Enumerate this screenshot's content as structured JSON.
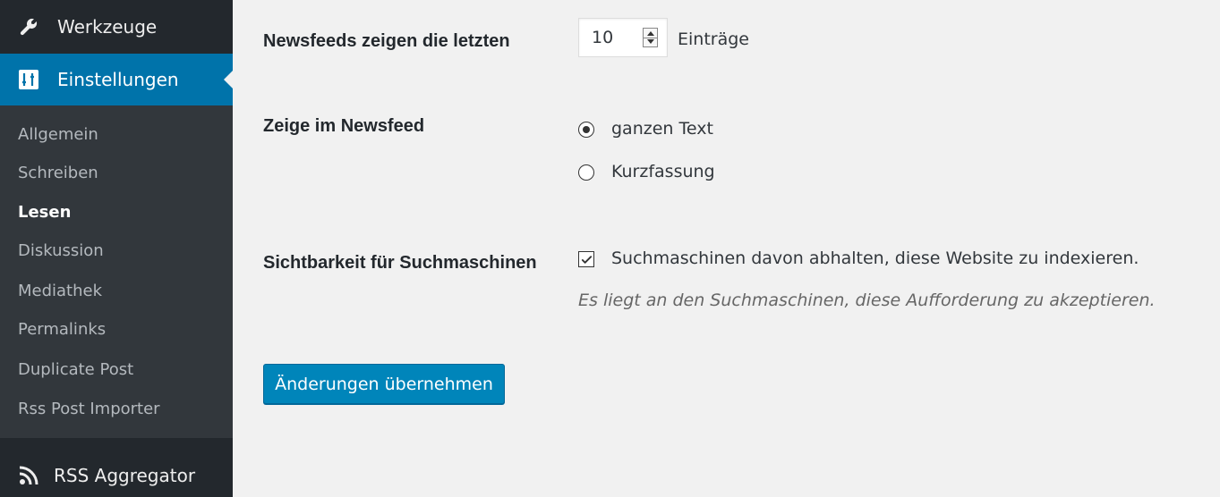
{
  "sidebar": {
    "menu": [
      {
        "label": "Werkzeuge",
        "icon": "wrench-icon"
      },
      {
        "label": "Einstellungen",
        "icon": "settings-sliders-icon",
        "active": true
      }
    ],
    "submenu": [
      {
        "label": "Allgemein"
      },
      {
        "label": "Schreiben"
      },
      {
        "label": "Lesen",
        "current": true
      },
      {
        "label": "Diskussion"
      },
      {
        "label": "Mediathek"
      },
      {
        "label": "Permalinks"
      },
      {
        "label": "Duplicate Post"
      },
      {
        "label": "Rss Post Importer"
      }
    ],
    "rss": {
      "label": "RSS Aggregator",
      "icon": "rss-icon"
    }
  },
  "settings": {
    "feed_count": {
      "label": "Newsfeeds zeigen die letzten",
      "value": "10",
      "suffix": "Einträge"
    },
    "feed_content": {
      "label": "Zeige im Newsfeed",
      "options": [
        {
          "label": "ganzen Text",
          "checked": true
        },
        {
          "label": "Kurzfassung",
          "checked": false
        }
      ]
    },
    "search_visibility": {
      "label": "Sichtbarkeit für Suchmaschinen",
      "checkbox_label": "Suchmaschinen davon abhalten, diese Website zu indexieren.",
      "checked": true,
      "description": "Es liegt an den Suchmaschinen, diese Aufforderung zu akzeptieren."
    }
  },
  "save_button": {
    "label": "Änderungen übernehmen"
  },
  "colors": {
    "sidebar_bg": "#23282d",
    "submenu_bg": "#32373c",
    "accent": "#0073aa",
    "button": "#0085ba"
  }
}
